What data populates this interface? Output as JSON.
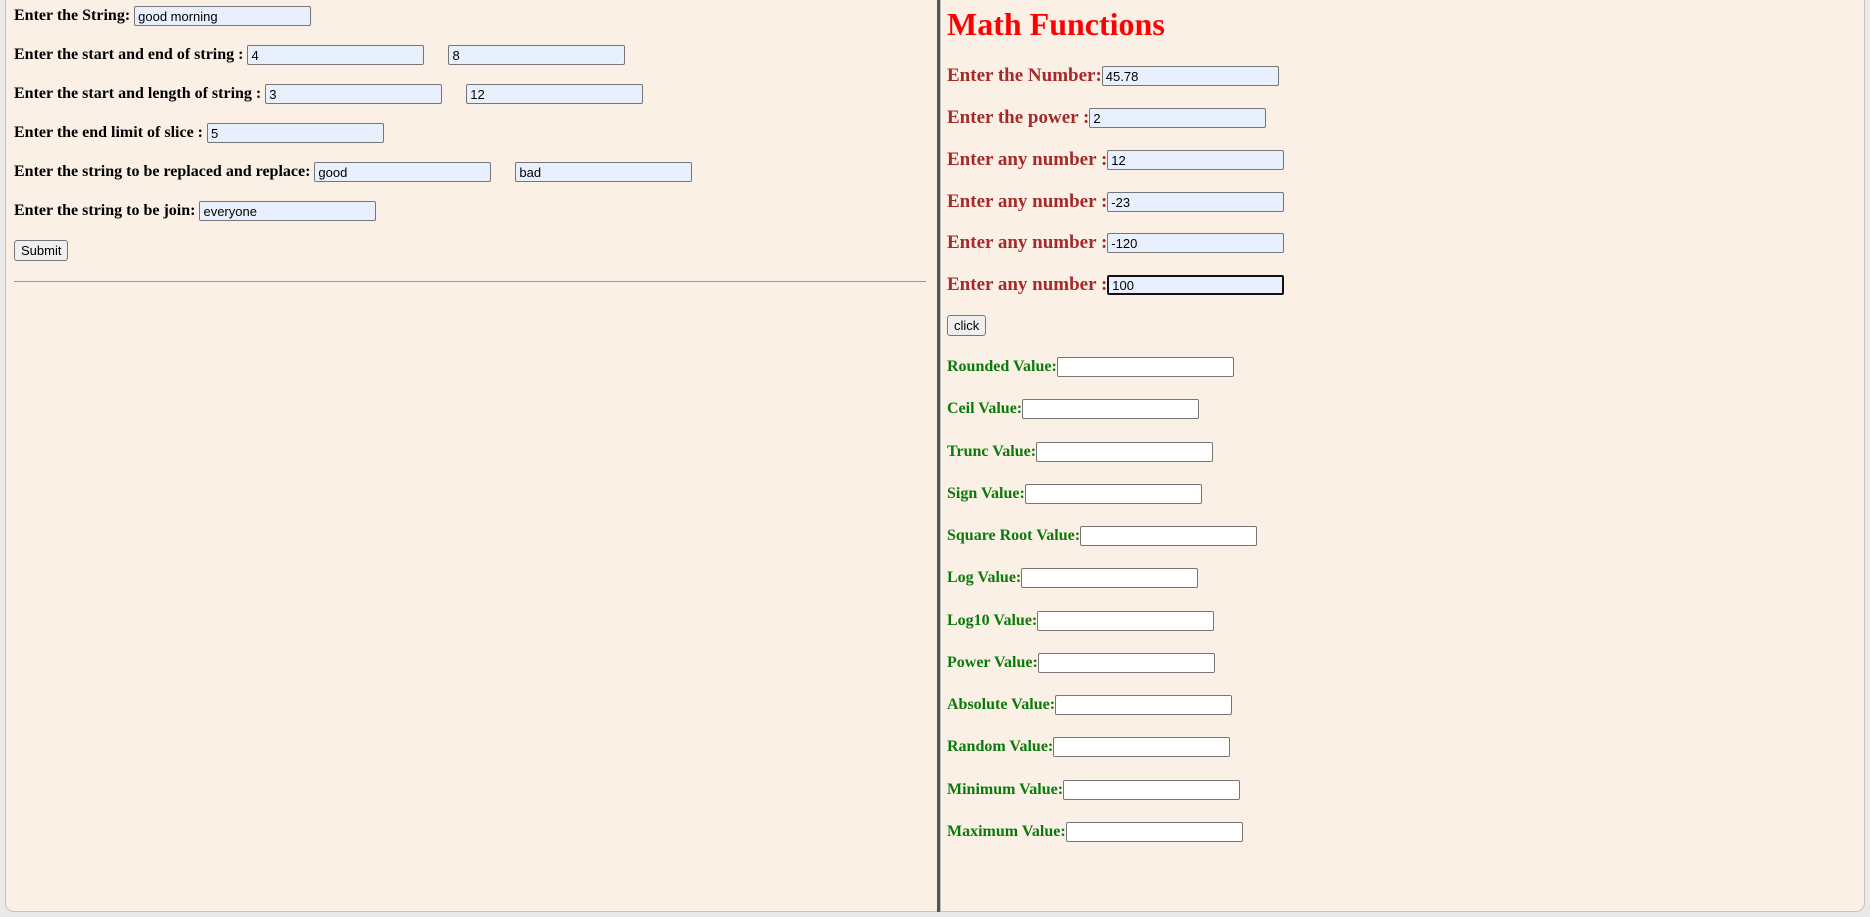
{
  "string_form": {
    "string_label": "Enter the String:",
    "string_value": "good morning",
    "start_end_label": "Enter the start and end of string :",
    "start_value": "4",
    "end_value": "8",
    "start_length_label": "Enter the start and length of string :",
    "start2_value": "3",
    "length_value": "12",
    "slice_label": "Enter the end limit of slice :",
    "slice_value": "5",
    "replace_label": "Enter the string to be replaced and replace:",
    "replace_from_value": "good",
    "replace_to_value": "bad",
    "join_label": "Enter the string to be join:",
    "join_value": "everyone",
    "submit_label": "Submit"
  },
  "math_form": {
    "title": "Math Functions",
    "number_label": "Enter the Number:",
    "number_value": "45.78",
    "power_label": "Enter the power :",
    "power_value": "2",
    "any_number_label": "Enter any number :",
    "any_numbers": [
      "12",
      "-23",
      "-120",
      "100"
    ],
    "click_label": "click",
    "results": [
      {
        "label": "Rounded Value:",
        "value": ""
      },
      {
        "label": "Ceil Value:",
        "value": ""
      },
      {
        "label": "Trunc Value:",
        "value": ""
      },
      {
        "label": "Sign Value:",
        "value": ""
      },
      {
        "label": "Square Root Value:",
        "value": ""
      },
      {
        "label": "Log Value:",
        "value": ""
      },
      {
        "label": "Log10 Value:",
        "value": ""
      },
      {
        "label": "Power Value:",
        "value": ""
      },
      {
        "label": "Absolute Value:",
        "value": ""
      },
      {
        "label": "Random Value:",
        "value": ""
      },
      {
        "label": "Minimum Value:",
        "value": ""
      },
      {
        "label": "Maximum Value:",
        "value": ""
      }
    ]
  },
  "colors": {
    "page_background": "#fbf0e6",
    "title": "#ff0000",
    "input_label": "#a52a2a",
    "result_label": "#0a7a0a",
    "autofill_input": "#e8f0fe"
  }
}
